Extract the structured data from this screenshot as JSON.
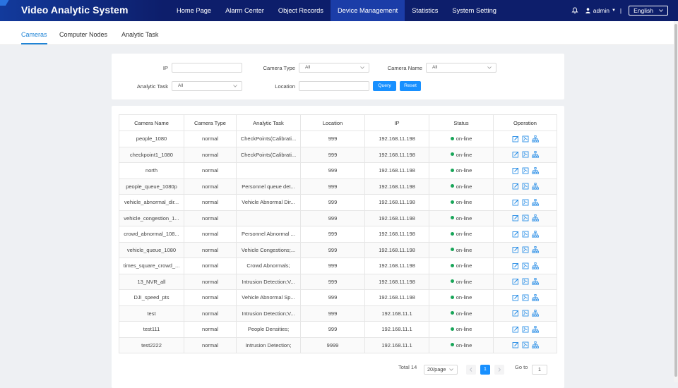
{
  "app": {
    "title": "Video Analytic System"
  },
  "nav": {
    "items": [
      "Home Page",
      "Alarm Center",
      "Object Records",
      "Device Management",
      "Statistics",
      "System Setting"
    ],
    "active_index": 3
  },
  "user": {
    "name": "admin",
    "separator": "|",
    "language": "English"
  },
  "subtabs": {
    "items": [
      "Cameras",
      "Computer Nodes",
      "Analytic Task"
    ],
    "active_index": 0
  },
  "filters": {
    "ip_label": "IP",
    "camera_type_label": "Camera Type",
    "camera_type_value": "All",
    "camera_name_label": "Camera Name",
    "camera_name_value": "All",
    "analytic_task_label": "Analytic Task",
    "analytic_task_value": "All",
    "location_label": "Location",
    "query_label": "Query",
    "reset_label": "Reset"
  },
  "table": {
    "headers": [
      "Camera Name",
      "Camera Type",
      "Analytic Task",
      "Location",
      "IP",
      "Status",
      "Operation"
    ],
    "rows": [
      [
        "people_1080",
        "normal",
        "CheckPoints(Calibrati...",
        "999",
        "192.168.11.198",
        "on-line"
      ],
      [
        "checkpoint1_1080",
        "normal",
        "CheckPoints(Calibrati...",
        "999",
        "192.168.11.198",
        "on-line"
      ],
      [
        "north",
        "normal",
        "",
        "999",
        "192.168.11.198",
        "on-line"
      ],
      [
        "people_queue_1080p",
        "normal",
        "Personnel queue det...",
        "999",
        "192.168.11.198",
        "on-line"
      ],
      [
        "vehicle_abnormal_dir...",
        "normal",
        "Vehicle Abnormal Dir...",
        "999",
        "192.168.11.198",
        "on-line"
      ],
      [
        "vehicle_congestion_1...",
        "normal",
        "",
        "999",
        "192.168.11.198",
        "on-line"
      ],
      [
        "crowd_abnormal_108...",
        "normal",
        "Personnel Abnormal ...",
        "999",
        "192.168.11.198",
        "on-line"
      ],
      [
        "vehicle_queue_1080",
        "normal",
        "Vehicle Congestions;...",
        "999",
        "192.168.11.198",
        "on-line"
      ],
      [
        "times_square_crowd_...",
        "normal",
        "Crowd Abnormals;",
        "999",
        "192.168.11.198",
        "on-line"
      ],
      [
        "13_NVR_all",
        "normal",
        "Intrusion Detection;V...",
        "999",
        "192.168.11.198",
        "on-line"
      ],
      [
        "DJI_speed_pts",
        "normal",
        "Vehicle Abnormal Sp...",
        "999",
        "192.168.11.198",
        "on-line"
      ],
      [
        "test",
        "normal",
        "Intrusion Detection;V...",
        "999",
        "192.168.11.1",
        "on-line"
      ],
      [
        "test111",
        "normal",
        "People Densities;",
        "999",
        "192.168.11.1",
        "on-line"
      ],
      [
        "test2222",
        "normal",
        "Intrusion Detection;",
        "9999",
        "192.168.11.1",
        "on-line"
      ]
    ]
  },
  "pagination": {
    "total": "Total 14",
    "page_size": "20/page",
    "current_page": "1",
    "goto_label": "Go to",
    "goto_value": "1"
  },
  "colors": {
    "header_bg": "#0d1e6b",
    "nav_active_bg": "#1b3da8",
    "accent": "#1890ff",
    "online": "#18a558",
    "icon_blue": "#2a8ee6"
  },
  "icons": [
    "bell-icon",
    "user-icon",
    "chevron-down-icon",
    "edit-icon",
    "config-icon",
    "topology-icon",
    "chevron-left-icon",
    "chevron-right-icon"
  ]
}
